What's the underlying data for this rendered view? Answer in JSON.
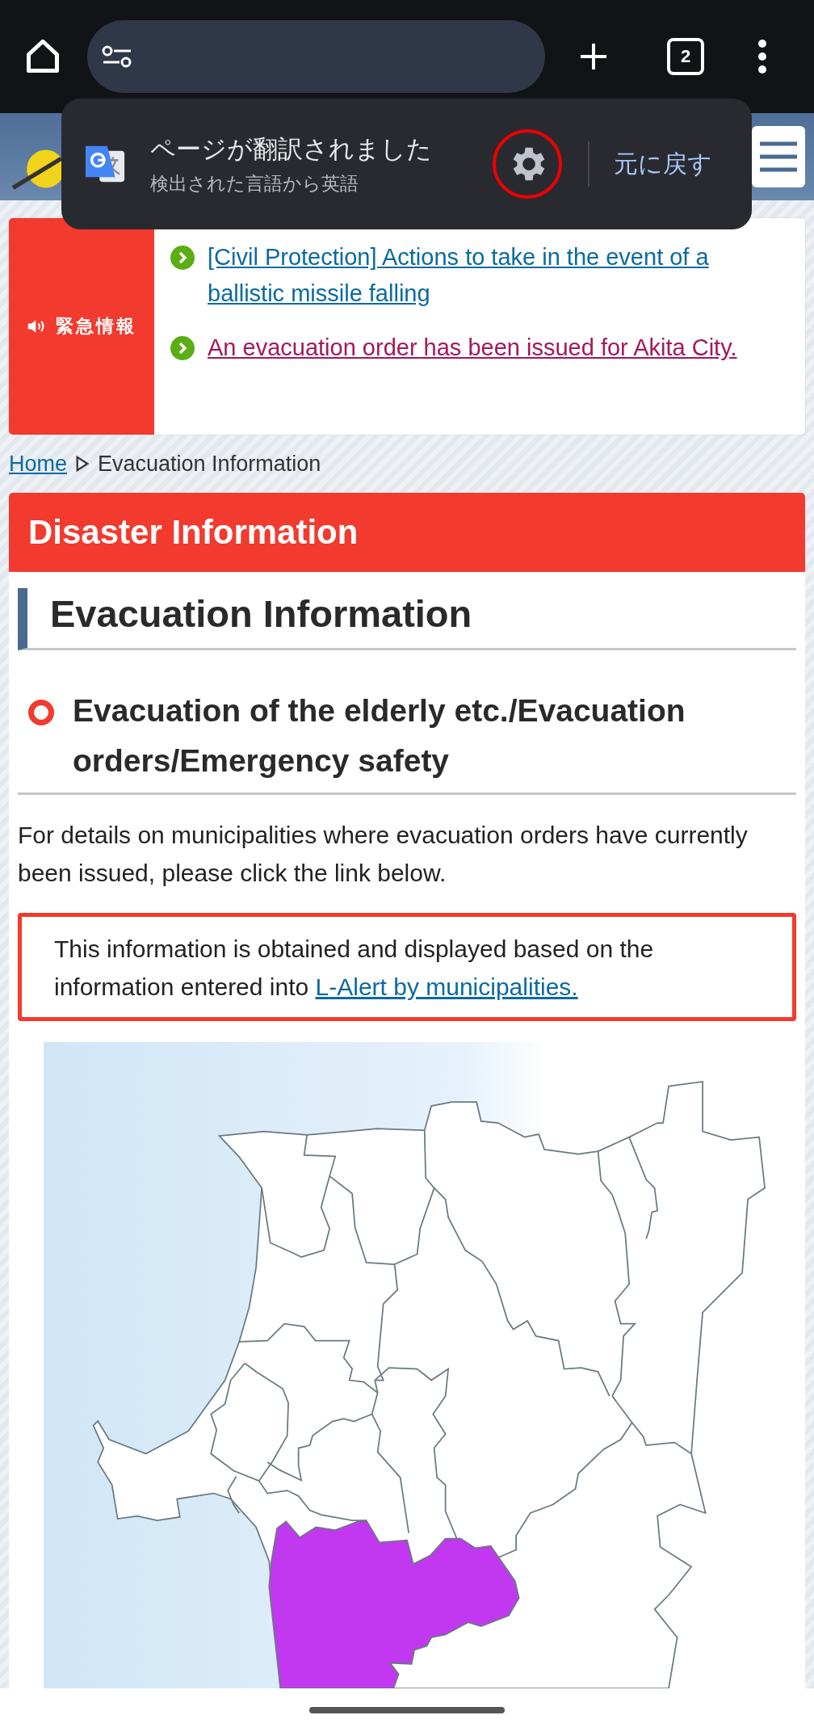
{
  "browser": {
    "tab_count": "2"
  },
  "translate_bar": {
    "title": "ページが翻訳されました",
    "subtitle": "検出された言語から英語",
    "undo": "元に戻す"
  },
  "alert": {
    "label": "緊急情報",
    "links": [
      {
        "text": "[Civil Protection] Actions to take in the event of a ballistic missile falling",
        "visited": false
      },
      {
        "text": "An evacuation order has been issued for Akita City.",
        "visited": true
      }
    ]
  },
  "breadcrumb": {
    "home": "Home",
    "current": "Evacuation Information"
  },
  "section_banner": "Disaster Information",
  "page_title": "Evacuation Information",
  "subsection_title": "Evacuation of the elderly etc./Evacuation orders/Emergency safety",
  "intro": "For details on municipalities where evacuation orders have currently been issued, please click the link below.",
  "notice": {
    "text": "This information is obtained and displayed based on the information entered into ",
    "link": "L-Alert by municipalities."
  }
}
